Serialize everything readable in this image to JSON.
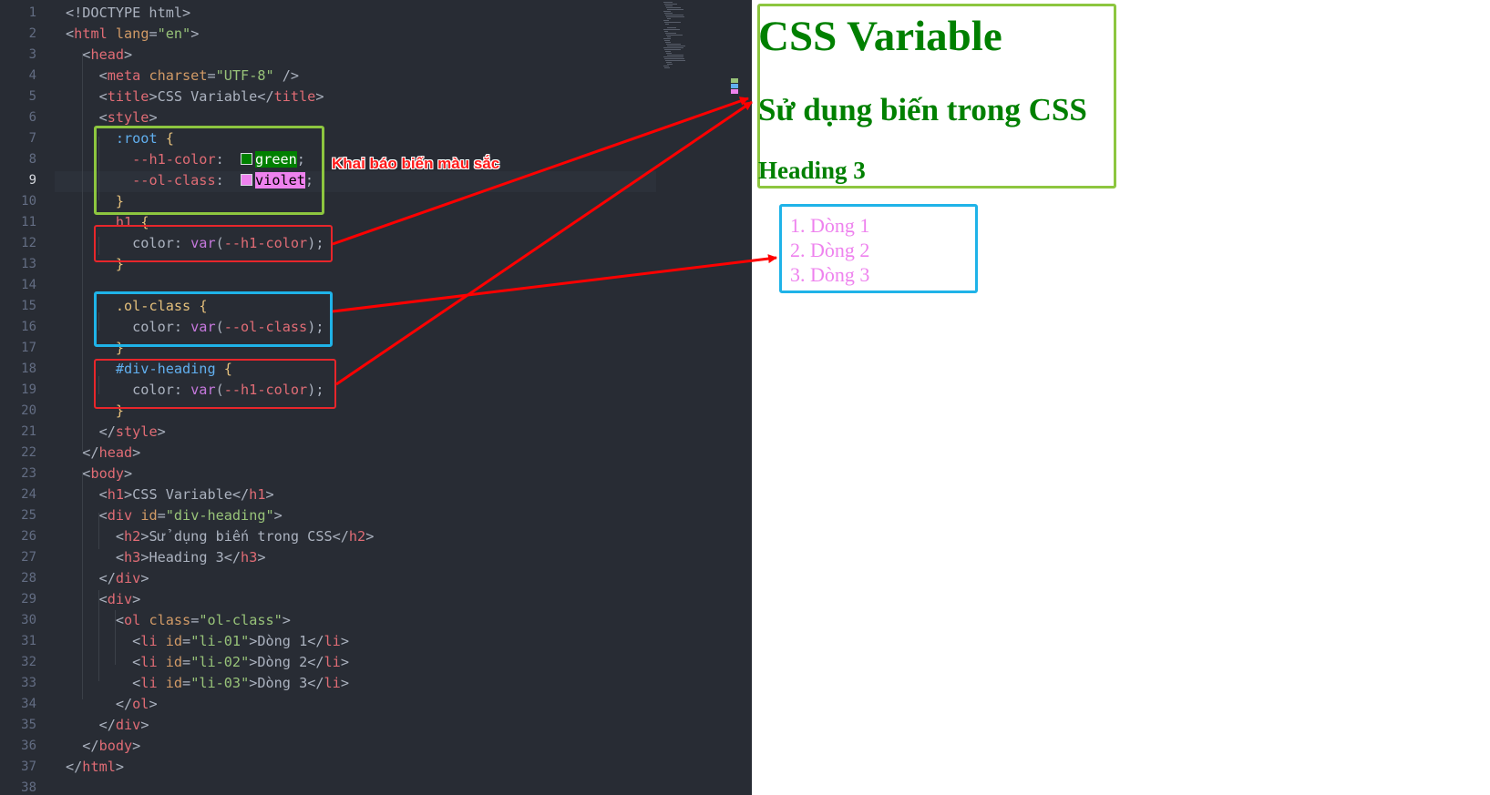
{
  "editor": {
    "active_line": 9,
    "line_numbers": [
      "1",
      "2",
      "3",
      "4",
      "5",
      "6",
      "7",
      "8",
      "9",
      "10",
      "11",
      "12",
      "13",
      "14",
      "15",
      "16",
      "17",
      "18",
      "19",
      "20",
      "21",
      "22",
      "23",
      "24",
      "25",
      "26",
      "27",
      "28",
      "29",
      "30",
      "31",
      "32",
      "33",
      "34",
      "35",
      "36",
      "37",
      "38"
    ],
    "lines": [
      [
        [
          "p",
          "<!DOCTYPE html>"
        ]
      ],
      [
        [
          "p",
          "<"
        ],
        [
          "t",
          "html"
        ],
        [
          "p",
          " "
        ],
        [
          "a",
          "lang"
        ],
        [
          "p",
          "="
        ],
        [
          "s",
          "\"en\""
        ],
        [
          "p",
          ">"
        ]
      ],
      [
        [
          "p",
          "  <"
        ],
        [
          "t",
          "head"
        ],
        [
          "p",
          ">"
        ]
      ],
      [
        [
          "p",
          "    <"
        ],
        [
          "t",
          "meta"
        ],
        [
          "p",
          " "
        ],
        [
          "a",
          "charset"
        ],
        [
          "p",
          "="
        ],
        [
          "s",
          "\"UTF-8\""
        ],
        [
          "p",
          " />"
        ]
      ],
      [
        [
          "p",
          "    <"
        ],
        [
          "t",
          "title"
        ],
        [
          "p",
          ">CSS Variable</"
        ],
        [
          "t",
          "title"
        ],
        [
          "p",
          ">"
        ]
      ],
      [
        [
          "p",
          "    <"
        ],
        [
          "t",
          "style"
        ],
        [
          "p",
          ">"
        ]
      ],
      [
        [
          "p",
          "      "
        ],
        [
          "sel",
          ":root"
        ],
        [
          "p",
          " "
        ],
        [
          "br",
          "{"
        ]
      ],
      [
        [
          "p",
          "        "
        ],
        [
          "v",
          "--h1-color"
        ],
        [
          "p",
          ":  "
        ],
        [
          "swg",
          ""
        ],
        [
          "hlg",
          "green"
        ],
        [
          "p",
          ";"
        ]
      ],
      [
        [
          "p",
          "        "
        ],
        [
          "v",
          "--ol-class"
        ],
        [
          "p",
          ":  "
        ],
        [
          "swv",
          ""
        ],
        [
          "hlv",
          "violet"
        ],
        [
          "p",
          ";"
        ]
      ],
      [
        [
          "p",
          "      "
        ],
        [
          "br",
          "}"
        ]
      ],
      [
        [
          "p",
          "      "
        ],
        [
          "t",
          "h1"
        ],
        [
          "p",
          " "
        ],
        [
          "br",
          "{"
        ]
      ],
      [
        [
          "p",
          "        color: "
        ],
        [
          "f",
          "var"
        ],
        [
          "p",
          "("
        ],
        [
          "v",
          "--h1-color"
        ],
        [
          "p",
          ");"
        ]
      ],
      [
        [
          "p",
          "      "
        ],
        [
          "br",
          "}"
        ]
      ],
      [
        [
          "p",
          ""
        ]
      ],
      [
        [
          "p",
          "      "
        ],
        [
          "d",
          ".ol-class"
        ],
        [
          "p",
          " "
        ],
        [
          "br",
          "{"
        ]
      ],
      [
        [
          "p",
          "        color: "
        ],
        [
          "f",
          "var"
        ],
        [
          "p",
          "("
        ],
        [
          "v",
          "--ol-class"
        ],
        [
          "p",
          ");"
        ]
      ],
      [
        [
          "p",
          "      "
        ],
        [
          "br",
          "}"
        ]
      ],
      [
        [
          "p",
          "      "
        ],
        [
          "sel",
          "#div-heading"
        ],
        [
          "p",
          " "
        ],
        [
          "br",
          "{"
        ]
      ],
      [
        [
          "p",
          "        color: "
        ],
        [
          "f",
          "var"
        ],
        [
          "p",
          "("
        ],
        [
          "v",
          "--h1-color"
        ],
        [
          "p",
          ");"
        ]
      ],
      [
        [
          "p",
          "      "
        ],
        [
          "br",
          "}"
        ]
      ],
      [
        [
          "p",
          "    </"
        ],
        [
          "t",
          "style"
        ],
        [
          "p",
          ">"
        ]
      ],
      [
        [
          "p",
          "  </"
        ],
        [
          "t",
          "head"
        ],
        [
          "p",
          ">"
        ]
      ],
      [
        [
          "p",
          "  <"
        ],
        [
          "t",
          "body"
        ],
        [
          "p",
          ">"
        ]
      ],
      [
        [
          "p",
          "    <"
        ],
        [
          "t",
          "h1"
        ],
        [
          "p",
          ">CSS Variable</"
        ],
        [
          "t",
          "h1"
        ],
        [
          "p",
          ">"
        ]
      ],
      [
        [
          "p",
          "    <"
        ],
        [
          "t",
          "div"
        ],
        [
          "p",
          " "
        ],
        [
          "a",
          "id"
        ],
        [
          "p",
          "="
        ],
        [
          "s",
          "\"div-heading\""
        ],
        [
          "p",
          ">"
        ]
      ],
      [
        [
          "p",
          "      <"
        ],
        [
          "t",
          "h2"
        ],
        [
          "p",
          ">Sử dụng biến trong CSS</"
        ],
        [
          "t",
          "h2"
        ],
        [
          "p",
          ">"
        ]
      ],
      [
        [
          "p",
          "      <"
        ],
        [
          "t",
          "h3"
        ],
        [
          "p",
          ">Heading 3</"
        ],
        [
          "t",
          "h3"
        ],
        [
          "p",
          ">"
        ]
      ],
      [
        [
          "p",
          "    </"
        ],
        [
          "t",
          "div"
        ],
        [
          "p",
          ">"
        ]
      ],
      [
        [
          "p",
          "    <"
        ],
        [
          "t",
          "div"
        ],
        [
          "p",
          ">"
        ]
      ],
      [
        [
          "p",
          "      <"
        ],
        [
          "t",
          "ol"
        ],
        [
          "p",
          " "
        ],
        [
          "a",
          "class"
        ],
        [
          "p",
          "="
        ],
        [
          "s",
          "\"ol-class\""
        ],
        [
          "p",
          ">"
        ]
      ],
      [
        [
          "p",
          "        <"
        ],
        [
          "t",
          "li"
        ],
        [
          "p",
          " "
        ],
        [
          "a",
          "id"
        ],
        [
          "p",
          "="
        ],
        [
          "s",
          "\"li-01\""
        ],
        [
          "p",
          ">Dòng 1</"
        ],
        [
          "t",
          "li"
        ],
        [
          "p",
          ">"
        ]
      ],
      [
        [
          "p",
          "        <"
        ],
        [
          "t",
          "li"
        ],
        [
          "p",
          " "
        ],
        [
          "a",
          "id"
        ],
        [
          "p",
          "="
        ],
        [
          "s",
          "\"li-02\""
        ],
        [
          "p",
          ">Dòng 2</"
        ],
        [
          "t",
          "li"
        ],
        [
          "p",
          ">"
        ]
      ],
      [
        [
          "p",
          "        <"
        ],
        [
          "t",
          "li"
        ],
        [
          "p",
          " "
        ],
        [
          "a",
          "id"
        ],
        [
          "p",
          "="
        ],
        [
          "s",
          "\"li-03\""
        ],
        [
          "p",
          ">Dòng 3</"
        ],
        [
          "t",
          "li"
        ],
        [
          "p",
          ">"
        ]
      ],
      [
        [
          "p",
          "      </"
        ],
        [
          "t",
          "ol"
        ],
        [
          "p",
          ">"
        ]
      ],
      [
        [
          "p",
          "    </"
        ],
        [
          "t",
          "div"
        ],
        [
          "p",
          ">"
        ]
      ],
      [
        [
          "p",
          "  </"
        ],
        [
          "t",
          "body"
        ],
        [
          "p",
          ">"
        ]
      ],
      [
        [
          "p",
          "</"
        ],
        [
          "t",
          "html"
        ],
        [
          "p",
          ">"
        ]
      ],
      [
        [
          "p",
          ""
        ]
      ]
    ]
  },
  "annotation": {
    "label": "Khai báo biến màu sắc"
  },
  "preview": {
    "h1": "CSS Variable",
    "h2": "Sử dụng biến trong CSS",
    "h3": "Heading 3",
    "list_items": [
      "1. Dòng 1",
      "2. Dòng 2",
      "3. Dòng 3"
    ]
  },
  "colors": {
    "editor_bg": "#282c34",
    "heading_color": "#008000",
    "list_color": "#ee82ee",
    "box_green": "#8dc63f",
    "box_red": "#e8262b",
    "box_blue": "#1fb3e8",
    "arrow_red": "#ff0000"
  }
}
